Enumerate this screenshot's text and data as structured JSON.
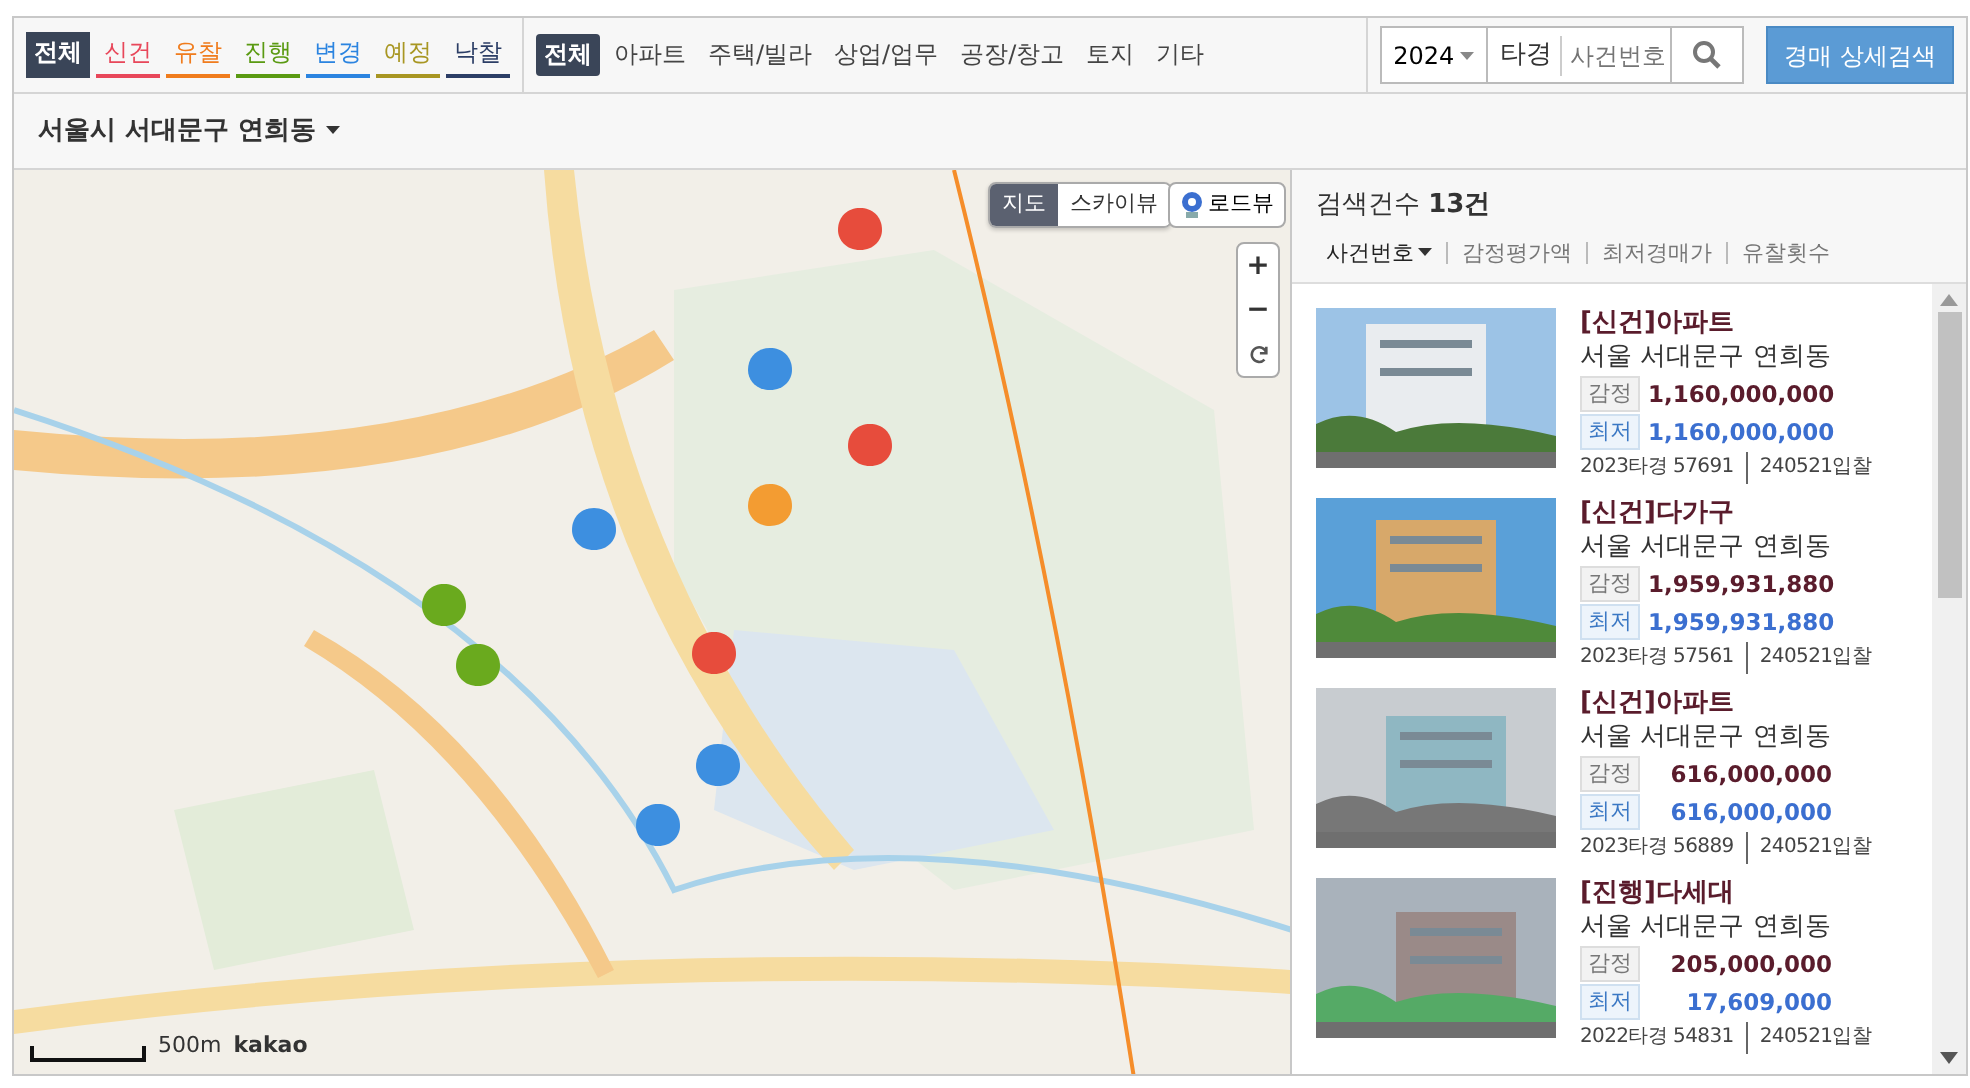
{
  "status_filters": [
    {
      "label": "전체",
      "selected": true
    },
    {
      "label": "신건",
      "selected": false,
      "color": "#e8475a"
    },
    {
      "label": "유찰",
      "selected": false,
      "color": "#f07c1d"
    },
    {
      "label": "진행",
      "selected": false,
      "color": "#5a9a12"
    },
    {
      "label": "변경",
      "selected": false,
      "color": "#2b84e0"
    },
    {
      "label": "예정",
      "selected": false,
      "color": "#a89622"
    },
    {
      "label": "낙찰",
      "selected": false,
      "color": "#2c3e66"
    }
  ],
  "type_filters": [
    {
      "label": "전체",
      "selected": true
    },
    {
      "label": "아파트",
      "selected": false
    },
    {
      "label": "주택/빌라",
      "selected": false
    },
    {
      "label": "상업/업무",
      "selected": false
    },
    {
      "label": "공장/창고",
      "selected": false
    },
    {
      "label": "토지",
      "selected": false
    },
    {
      "label": "기타",
      "selected": false
    }
  ],
  "case_search": {
    "year": "2024",
    "court_code": "타경",
    "placeholder": "사건번호"
  },
  "detail_search_button": "경매 상세검색",
  "region": "서울시 서대문구 연희동",
  "map": {
    "view_modes": [
      {
        "label": "지도",
        "selected": true
      },
      {
        "label": "스카이뷰",
        "selected": false
      }
    ],
    "roadview_button": "로드뷰",
    "zoom_in": "+",
    "zoom_out": "−",
    "scale": "500m",
    "attribution": "kakao"
  },
  "results": {
    "count_label": "검색건수",
    "count": "13건",
    "sort_options": [
      {
        "label": "사건번호",
        "selected": true
      },
      {
        "label": "감정평가액",
        "selected": false
      },
      {
        "label": "최저경매가",
        "selected": false
      },
      {
        "label": "유찰횟수",
        "selected": false
      }
    ],
    "items": [
      {
        "title": "[신건]아파트",
        "address": "서울 서대문구 연희동",
        "appraisal_label": "감정",
        "appraisal": "1,160,000,000",
        "minimum_label": "최저",
        "minimum": "1,160,000,000",
        "case_no": "2023타경 57691",
        "bid_date": "240521입찰"
      },
      {
        "title": "[신건]다가구",
        "address": "서울 서대문구 연희동",
        "appraisal_label": "감정",
        "appraisal": "1,959,931,880",
        "minimum_label": "최저",
        "minimum": "1,959,931,880",
        "case_no": "2023타경 57561",
        "bid_date": "240521입찰"
      },
      {
        "title": "[신건]아파트",
        "address": "서울 서대문구 연희동",
        "appraisal_label": "감정",
        "appraisal": "616,000,000",
        "minimum_label": "최저",
        "minimum": "616,000,000",
        "case_no": "2023타경 56889",
        "bid_date": "240521입찰"
      },
      {
        "title": "[진행]다세대",
        "address": "서울 서대문구 연희동",
        "appraisal_label": "감정",
        "appraisal": "205,000,000",
        "minimum_label": "최저",
        "minimum": "17,609,000",
        "case_no": "2022타경 54831",
        "bid_date": "240521입찰"
      }
    ]
  }
}
